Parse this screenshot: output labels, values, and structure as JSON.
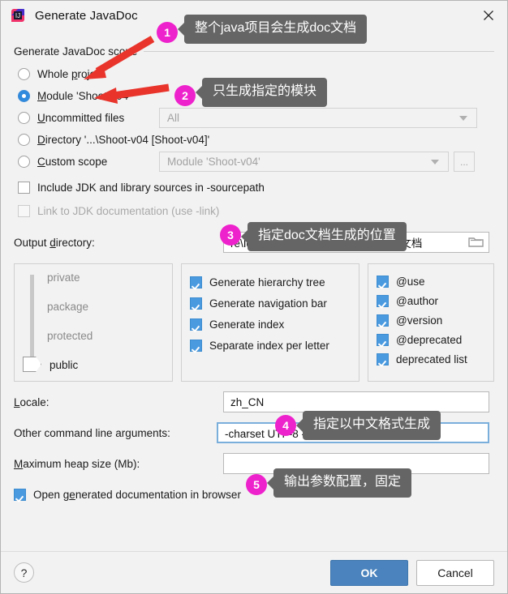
{
  "window": {
    "title": "Generate JavaDoc",
    "app_icon": "intellij-idea-icon",
    "close_label": "✕"
  },
  "scope": {
    "group_label": "Generate JavaDoc scope",
    "options": [
      {
        "label_pre": "Whole ",
        "mnemonic": "p",
        "label_post": "roject",
        "checked": false,
        "name": "whole-project"
      },
      {
        "label_pre": "",
        "mnemonic": "M",
        "label_post": "odule 'Shoot-v04'",
        "checked": true,
        "name": "module"
      },
      {
        "label_pre": "",
        "mnemonic": "U",
        "label_post": "ncommitted files",
        "checked": false,
        "name": "uncommitted-files"
      },
      {
        "label_pre": "",
        "mnemonic": "D",
        "label_post": "irectory '...\\Shoot-v04 [Shoot-v04]'",
        "checked": false,
        "name": "directory"
      },
      {
        "label_pre": "",
        "mnemonic": "C",
        "label_post": "ustom scope",
        "checked": false,
        "name": "custom-scope"
      }
    ],
    "uncommitted_combo_value": "All",
    "custom_scope_combo_value": "Module 'Shoot-v04'",
    "browse_label": "..."
  },
  "checkboxes": {
    "include_jdk": {
      "pre": "Include JDK and library sources in -sourcepath",
      "checked": false,
      "disabled": false
    },
    "link_jdk": {
      "pre": "Link to JDK documentation (use -link)",
      "checked": false,
      "disabled": true
    }
  },
  "output": {
    "label_pre": "Output ",
    "label_mnemonic": "d",
    "label_post": "irectory:",
    "value": "re\\IdeaProjects\\Shoot\\射击游戏doc文档",
    "browse_icon": "folder-icon"
  },
  "visibility": {
    "ticks": [
      "private",
      "package",
      "protected",
      "public"
    ],
    "selected": "public"
  },
  "generate_options": [
    {
      "label": "Generate hierarchy tree",
      "checked": true,
      "name": "generate-hierarchy-tree"
    },
    {
      "label": "Generate navigation bar",
      "checked": true,
      "name": "generate-navigation-bar"
    },
    {
      "label": "Generate index",
      "checked": true,
      "name": "generate-index"
    },
    {
      "label": "Separate index per letter",
      "checked": true,
      "name": "separate-index-per-letter"
    }
  ],
  "tag_options": [
    {
      "label": "@use",
      "checked": true,
      "name": "tag-use"
    },
    {
      "label": "@author",
      "checked": true,
      "name": "tag-author"
    },
    {
      "label": "@version",
      "checked": true,
      "name": "tag-version"
    },
    {
      "label": "@deprecated",
      "checked": true,
      "name": "tag-deprecated"
    },
    {
      "label": "deprecated list",
      "checked": true,
      "name": "tag-deprecated-list"
    }
  ],
  "locale": {
    "label_mnemonic": "L",
    "label_post": "ocale:",
    "value": "zh_CN"
  },
  "cmdargs": {
    "label_pre": "Other command line arguments:",
    "value": "-charset UTF-8 -windowtitle \"程Sir小课堂\" -"
  },
  "heap": {
    "label_mnemonic": "M",
    "label_post": "aximum heap size (Mb):",
    "value": ""
  },
  "open_browser": {
    "label_pre": "Open g",
    "label_mnemonic": "e",
    "label_post": "nerated documentation in browser",
    "checked": true
  },
  "buttons": {
    "help": "?",
    "ok": "OK",
    "cancel": "Cancel"
  },
  "annotations": {
    "accent_badge_color": "#ee22cc",
    "callout_bg": "#656565",
    "arrow_color": "#e8342b",
    "items": [
      {
        "number": "1",
        "text": "整个java项目会生成doc文档"
      },
      {
        "number": "2",
        "text": "只生成指定的模块"
      },
      {
        "number": "3",
        "text": "指定doc文档生成的位置"
      },
      {
        "number": "4",
        "text": "指定以中文格式生成"
      },
      {
        "number": "5",
        "text": "输出参数配置，固定"
      }
    ]
  }
}
